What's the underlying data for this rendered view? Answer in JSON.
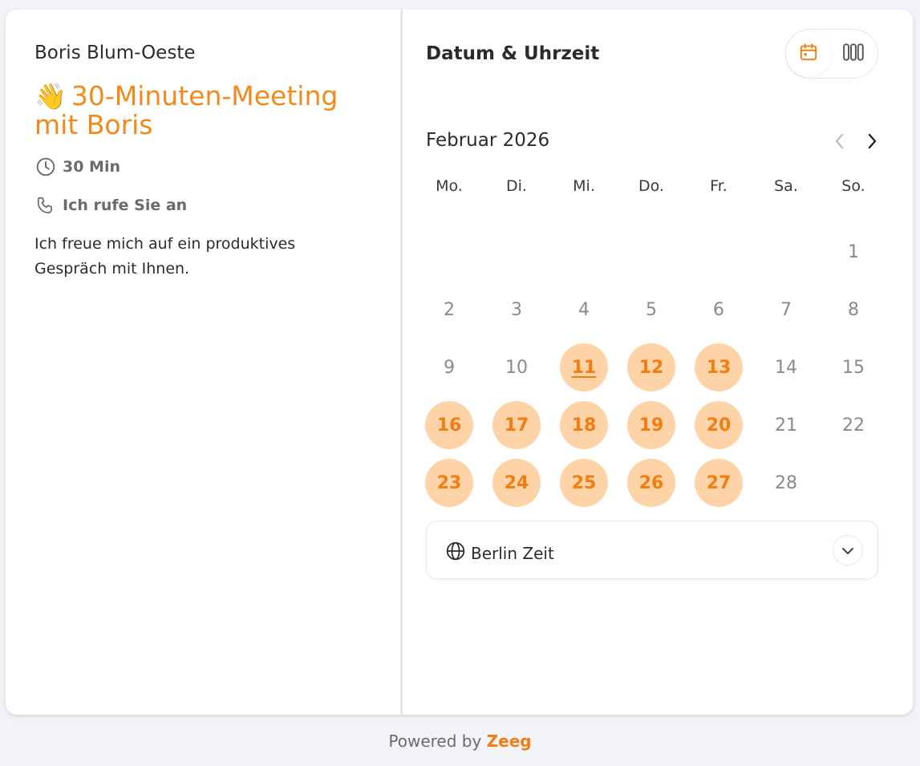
{
  "host": {
    "name": "Boris Blum-Oeste"
  },
  "event": {
    "emoji": "👋",
    "title": "30-Minuten-Meeting mit Boris",
    "duration": "30 Min",
    "location": "Ich rufe Sie an",
    "description": "Ich freue mich auf ein produktives Gespräch mit Ihnen."
  },
  "scheduler": {
    "section_title": "Datum & Uhrzeit",
    "view_toggle": [
      {
        "icon": "calendar-icon",
        "active": true
      },
      {
        "icon": "columns-icon",
        "active": false
      }
    ],
    "month_label": "Februar 2026",
    "weekdays": [
      "Mo.",
      "Di.",
      "Mi.",
      "Do.",
      "Fr.",
      "Sa.",
      "So."
    ],
    "days": [
      {
        "n": "",
        "a": false
      },
      {
        "n": "",
        "a": false
      },
      {
        "n": "",
        "a": false
      },
      {
        "n": "",
        "a": false
      },
      {
        "n": "",
        "a": false
      },
      {
        "n": "",
        "a": false
      },
      {
        "n": "1",
        "a": false
      },
      {
        "n": "2",
        "a": false
      },
      {
        "n": "3",
        "a": false
      },
      {
        "n": "4",
        "a": false
      },
      {
        "n": "5",
        "a": false
      },
      {
        "n": "6",
        "a": false
      },
      {
        "n": "7",
        "a": false
      },
      {
        "n": "8",
        "a": false
      },
      {
        "n": "9",
        "a": false
      },
      {
        "n": "10",
        "a": false
      },
      {
        "n": "11",
        "a": true,
        "today": true
      },
      {
        "n": "12",
        "a": true
      },
      {
        "n": "13",
        "a": true
      },
      {
        "n": "14",
        "a": false
      },
      {
        "n": "15",
        "a": false
      },
      {
        "n": "16",
        "a": true
      },
      {
        "n": "17",
        "a": true
      },
      {
        "n": "18",
        "a": true
      },
      {
        "n": "19",
        "a": true
      },
      {
        "n": "20",
        "a": true
      },
      {
        "n": "21",
        "a": false
      },
      {
        "n": "22",
        "a": false
      },
      {
        "n": "23",
        "a": true
      },
      {
        "n": "24",
        "a": true
      },
      {
        "n": "25",
        "a": true
      },
      {
        "n": "26",
        "a": true
      },
      {
        "n": "27",
        "a": true
      },
      {
        "n": "28",
        "a": false
      },
      {
        "n": "",
        "a": false
      }
    ],
    "timezone": "Berlin Zeit"
  },
  "footer": {
    "prefix": "Powered by",
    "brand": "Zeeg"
  },
  "colors": {
    "accent": "#f27d10",
    "accent_light": "#fdd3a7"
  }
}
